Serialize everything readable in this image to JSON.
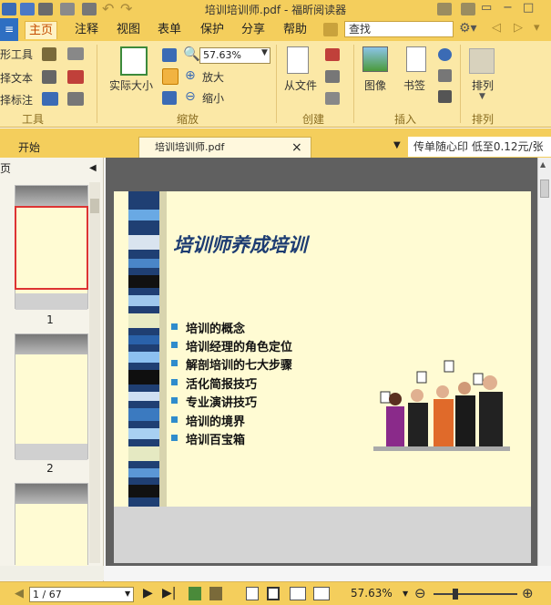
{
  "window": {
    "title": "培训培训师.pdf - 福昕阅读器"
  },
  "menubar": {
    "file": "≡",
    "items": [
      "主页",
      "注释",
      "视图",
      "表单",
      "保护",
      "分享",
      "帮助"
    ],
    "active": "主页",
    "search_placeholder": "查找"
  },
  "ribbon": {
    "tools": {
      "t1": "形工具",
      "t2": "择文本",
      "t3": "择标注",
      "group": "工具"
    },
    "zoom": {
      "actual": "实际大小",
      "level": "57.63%",
      "zoom_in": "放大",
      "zoom_out": "缩小",
      "group": "缩放"
    },
    "create": {
      "from_file": "从文件",
      "group": "创建"
    },
    "insert": {
      "image": "图像",
      "bookmark": "书签",
      "group": "插入"
    },
    "arrange": {
      "label": "排列",
      "group": "排列"
    }
  },
  "tabs": {
    "start": "开始",
    "doc": "培训培训师.pdf",
    "close": "×",
    "ad": "传单随心印 低至0.12元/张"
  },
  "panel": {
    "header": "页",
    "pages": [
      "1",
      "2"
    ]
  },
  "document": {
    "title": "培训师养成培训",
    "bullets": [
      "培训的概念",
      "培训经理的角色定位",
      "解剖培训的七大步骤",
      "活化简报技巧",
      "专业演讲技巧",
      "培训的境界",
      "培训百宝箱"
    ]
  },
  "status": {
    "page": "1 / 67",
    "zoom": "57.63%"
  },
  "colors": {
    "accent": "#f4ce5c",
    "ribbon": "#fbe8a6",
    "slide_bg": "#fffbd3",
    "title": "#1d3c72",
    "bullet": "#2f8ccc"
  }
}
